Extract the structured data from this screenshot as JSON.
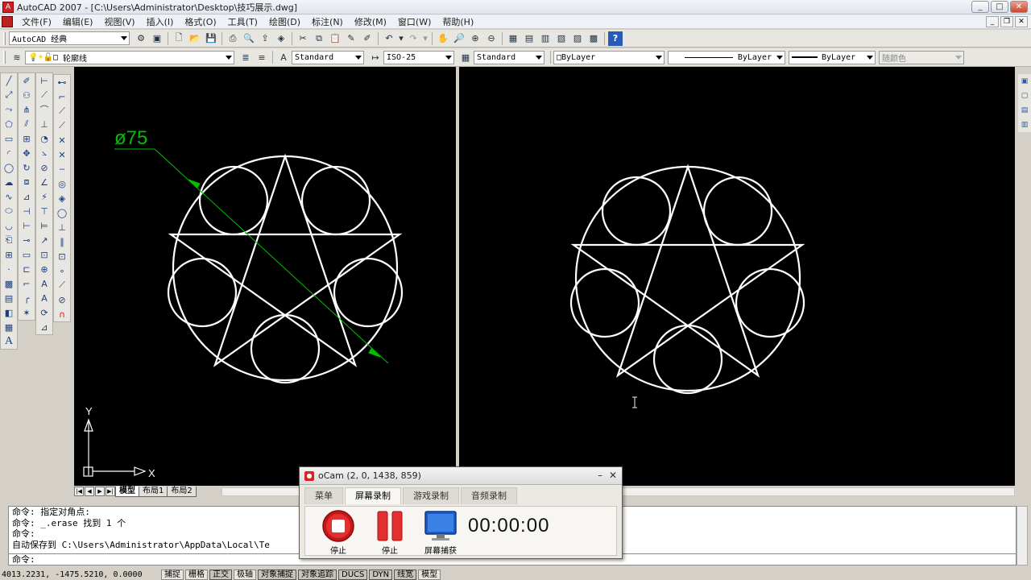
{
  "window": {
    "title": "AutoCAD 2007 - [C:\\Users\\Administrator\\Desktop\\技巧展示.dwg]"
  },
  "menu": [
    "文件(F)",
    "编辑(E)",
    "视图(V)",
    "插入(I)",
    "格式(O)",
    "工具(T)",
    "绘图(D)",
    "标注(N)",
    "修改(M)",
    "窗口(W)",
    "帮助(H)"
  ],
  "toolbar1": {
    "workspace": "AutoCAD 经典"
  },
  "toolbar2": {
    "layer": "轮廓线",
    "text_style": "Standard",
    "dim_style": "ISO-25",
    "table_style": "Standard",
    "color": "ByLayer",
    "linetype": "ByLayer",
    "lineweight": "ByLayer",
    "plot_style": "随颜色"
  },
  "drawing": {
    "dimension_text": "ø75",
    "ucs_x": "X",
    "ucs_y": "Y",
    "colors": {
      "geometry": "#ffffff",
      "dimension": "#00c000",
      "background": "#000000"
    }
  },
  "layout_tabs": [
    "模型",
    "布局1",
    "布局2"
  ],
  "command_history": [
    "命令: 指定对角点:",
    "命令: _.erase 找到 1 个",
    "命令:",
    "自动保存到 C:\\Users\\Administrator\\AppData\\Local\\Te"
  ],
  "command_prompt": "命令:",
  "status": {
    "coords": "4013.2231, -1475.5210, 0.0000",
    "toggles": [
      "捕捉",
      "栅格",
      "正交",
      "极轴",
      "对象捕捉",
      "对象追踪",
      "DUCS",
      "DYN",
      "线宽",
      "模型"
    ]
  },
  "ocam": {
    "title": "oCam (2, 0, 1438, 859)",
    "tabs": [
      "菜单",
      "屏幕录制",
      "游戏录制",
      "音频录制"
    ],
    "stop_label": "停止",
    "pause_label": "停止",
    "capture_label": "屏幕捕获",
    "timer": "00:00:00"
  }
}
